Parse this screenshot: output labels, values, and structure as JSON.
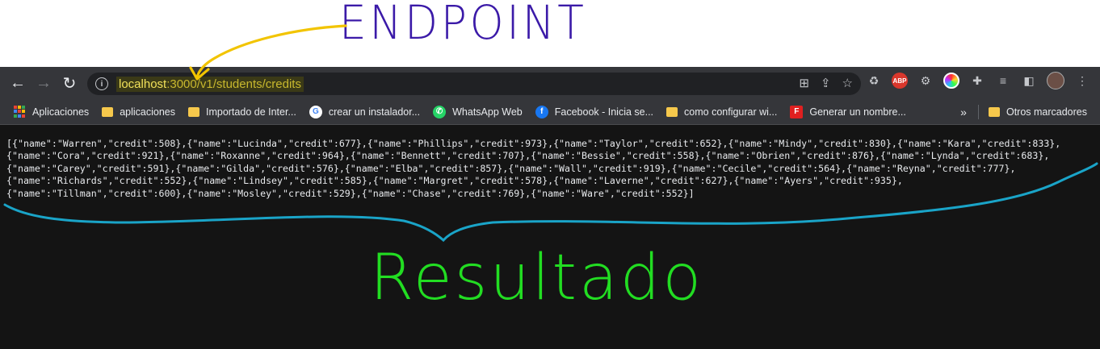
{
  "annotations": {
    "endpoint_label": "ENDPOINT",
    "result_label": "Resultado",
    "endpoint_color": "#3b1aa8",
    "arrow_color": "#f2c400",
    "result_color": "#22dd22",
    "brace_color": "#1aa4c8"
  },
  "toolbar": {
    "back_icon": "arrow-left-icon",
    "forward_icon": "arrow-right-icon",
    "reload_icon": "reload-icon",
    "url_host": "localhost",
    "url_rest": ":3000/v1/students/credits"
  },
  "bookmarks": [
    {
      "label": "Aplicaciones",
      "icon": "apps-grid-icon"
    },
    {
      "label": "aplicaciones",
      "icon": "folder-icon"
    },
    {
      "label": "Importado de Inter...",
      "icon": "folder-icon"
    },
    {
      "label": "crear un instalador...",
      "icon": "google-icon"
    },
    {
      "label": "WhatsApp Web",
      "icon": "whatsapp-icon"
    },
    {
      "label": "Facebook - Inicia se...",
      "icon": "facebook-icon"
    },
    {
      "label": "como configurar wi...",
      "icon": "folder-icon"
    },
    {
      "label": "Generar un nombre...",
      "icon": "f-icon"
    }
  ],
  "other_bookmarks": "Otros marcadores",
  "more_bookmarks": "»",
  "json_lines": [
    "[{\"name\":\"Warren\",\"credit\":508},{\"name\":\"Lucinda\",\"credit\":677},{\"name\":\"Phillips\",\"credit\":973},{\"name\":\"Taylor\",\"credit\":652},{\"name\":\"Mindy\",\"credit\":830},{\"name\":\"Kara\",\"credit\":833},",
    "{\"name\":\"Cora\",\"credit\":921},{\"name\":\"Roxanne\",\"credit\":964},{\"name\":\"Bennett\",\"credit\":707},{\"name\":\"Bessie\",\"credit\":558},{\"name\":\"Obrien\",\"credit\":876},{\"name\":\"Lynda\",\"credit\":683},",
    "{\"name\":\"Carey\",\"credit\":591},{\"name\":\"Gilda\",\"credit\":576},{\"name\":\"Elba\",\"credit\":857},{\"name\":\"Wall\",\"credit\":919},{\"name\":\"Cecile\",\"credit\":564},{\"name\":\"Reyna\",\"credit\":777},",
    "{\"name\":\"Richards\",\"credit\":552},{\"name\":\"Lindsey\",\"credit\":585},{\"name\":\"Margret\",\"credit\":578},{\"name\":\"Laverne\",\"credit\":627},{\"name\":\"Ayers\",\"credit\":935},",
    "{\"name\":\"Tillman\",\"credit\":600},{\"name\":\"Mosley\",\"credit\":529},{\"name\":\"Chase\",\"credit\":769},{\"name\":\"Ware\",\"credit\":552}]"
  ]
}
